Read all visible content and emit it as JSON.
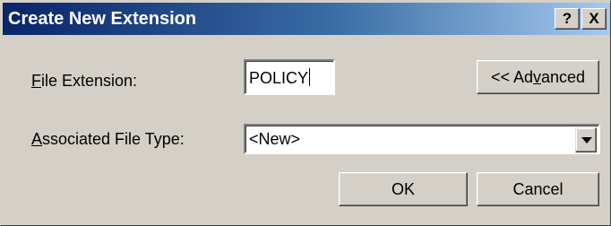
{
  "dialog": {
    "title": "Create New Extension",
    "help_label": "?",
    "close_label": "X"
  },
  "file_extension": {
    "label_accel": "F",
    "label_rest": "ile Extension:",
    "value": "POLICY"
  },
  "advanced_button": {
    "label_pre": "<< Ad",
    "label_accel": "v",
    "label_post": "anced"
  },
  "associated_type": {
    "label_accel": "A",
    "label_rest": "ssociated File Type:",
    "value": "<New>"
  },
  "buttons": {
    "ok": "OK",
    "cancel": "Cancel"
  },
  "icons": {
    "dropdown": "chevron-down-icon"
  }
}
